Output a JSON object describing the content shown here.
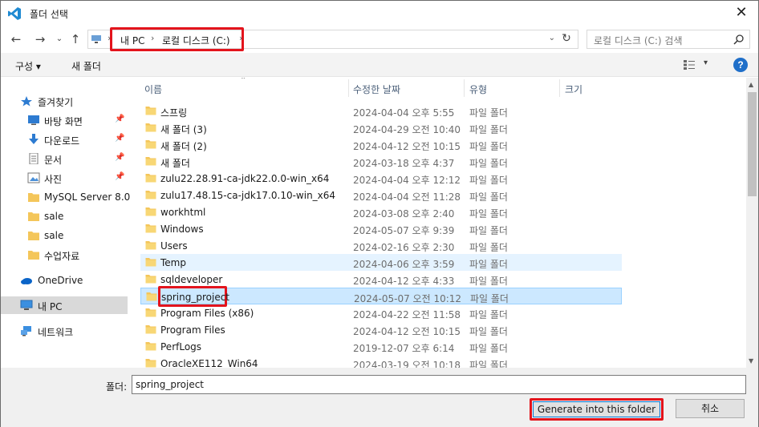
{
  "window": {
    "title": "폴더 선택",
    "close_glyph": "✕"
  },
  "nav": {
    "back_glyph": "←",
    "forward_glyph": "→",
    "recent_glyph": "⌄",
    "up_glyph": "↑",
    "address": {
      "crumbs": [
        "내 PC",
        "로컬 디스크 (C:)"
      ],
      "sep": "›",
      "dropdown_glyph": "⌄",
      "refresh_glyph": "↻"
    },
    "search": {
      "placeholder": "로컬 디스크 (C:) 검색"
    }
  },
  "toolbar": {
    "organize_label": "구성 ▾",
    "new_folder_label": "새 폴더",
    "view_glyph": "▾",
    "help_glyph": "?"
  },
  "sidebar": {
    "items": [
      {
        "label": "즐겨찾기",
        "icon": "star-icon",
        "pinned": false
      },
      {
        "label": "바탕 화면",
        "icon": "desktop-icon",
        "pinned": true
      },
      {
        "label": "다운로드",
        "icon": "download-icon",
        "pinned": true
      },
      {
        "label": "문서",
        "icon": "document-icon",
        "pinned": true
      },
      {
        "label": "사진",
        "icon": "pictures-icon",
        "pinned": true
      },
      {
        "label": "MySQL Server 8.0",
        "icon": "folder-icon",
        "pinned": false
      },
      {
        "label": "sale",
        "icon": "folder-icon",
        "pinned": false
      },
      {
        "label": "sale",
        "icon": "folder-icon",
        "pinned": false
      },
      {
        "label": "수업자료",
        "icon": "folder-icon",
        "pinned": false
      },
      {
        "label": "OneDrive",
        "icon": "cloud-icon",
        "pinned": false
      },
      {
        "label": "내 PC",
        "icon": "pc-icon",
        "pinned": false
      },
      {
        "label": "네트워크",
        "icon": "network-icon",
        "pinned": false
      }
    ],
    "pin_glyph": "📌"
  },
  "filelist": {
    "columns": [
      "이름",
      "수정한 날짜",
      "유형",
      "크기"
    ],
    "sort_glyph": "⌃",
    "rows": [
      {
        "name": "스프링",
        "date": "2024-04-04 오후 5:55",
        "type": "파일 폴더"
      },
      {
        "name": "새 폴더 (3)",
        "date": "2024-04-29 오전 10:40",
        "type": "파일 폴더"
      },
      {
        "name": "새 폴더 (2)",
        "date": "2024-04-12 오전 10:15",
        "type": "파일 폴더"
      },
      {
        "name": "새 폴더",
        "date": "2024-03-18 오후 4:37",
        "type": "파일 폴더"
      },
      {
        "name": "zulu22.28.91-ca-jdk22.0.0-win_x64",
        "date": "2024-04-04 오후 12:12",
        "type": "파일 폴더"
      },
      {
        "name": "zulu17.48.15-ca-jdk17.0.10-win_x64",
        "date": "2024-04-04 오전 11:28",
        "type": "파일 폴더"
      },
      {
        "name": "workhtml",
        "date": "2024-03-08 오후 2:40",
        "type": "파일 폴더"
      },
      {
        "name": "Windows",
        "date": "2024-05-07 오후 9:39",
        "type": "파일 폴더"
      },
      {
        "name": "Users",
        "date": "2024-02-16 오후 2:30",
        "type": "파일 폴더"
      },
      {
        "name": "Temp",
        "date": "2024-04-06 오후 3:59",
        "type": "파일 폴더"
      },
      {
        "name": "sqldeveloper",
        "date": "2024-04-12 오후 4:33",
        "type": "파일 폴더"
      },
      {
        "name": "spring_project",
        "date": "2024-05-07 오전 10:12",
        "type": "파일 폴더"
      },
      {
        "name": "Program Files (x86)",
        "date": "2024-04-22 오전 11:58",
        "type": "파일 폴더"
      },
      {
        "name": "Program Files",
        "date": "2024-04-12 오전 10:15",
        "type": "파일 폴더"
      },
      {
        "name": "PerfLogs",
        "date": "2019-12-07 오후 6:14",
        "type": "파일 폴더"
      },
      {
        "name": "OracleXE112_Win64",
        "date": "2024-03-19 오전 10:18",
        "type": "파일 폴더"
      }
    ],
    "hover_index": 9,
    "selected_index": 11
  },
  "scrollbar": {
    "up_glyph": "▲",
    "down_glyph": "▼"
  },
  "bottom": {
    "folder_label": "폴더:",
    "folder_value": "spring_project",
    "primary_button": "Generate into this folder",
    "cancel_button": "취소"
  },
  "colors": {
    "accent": "#0078d7",
    "highlight": "#e3141c",
    "selected_row": "#cce8ff",
    "hover_row": "#e5f3ff"
  }
}
